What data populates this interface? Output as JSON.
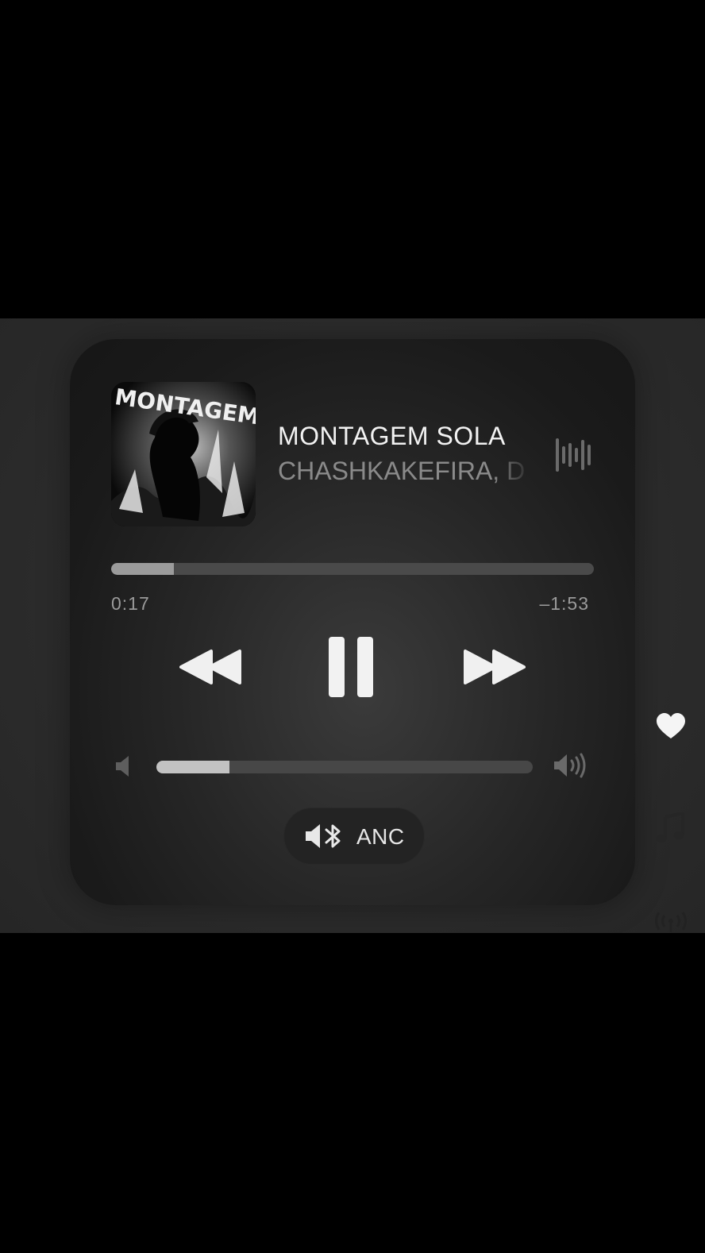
{
  "now_playing": {
    "title": "MONTAGEM SOLA",
    "artist": "CHASHKAKEFIRA, D",
    "album_art_text": "MONTAGEM"
  },
  "playback": {
    "elapsed": "0:17",
    "remaining": "–1:53",
    "progress_fraction": 0.13,
    "state": "playing"
  },
  "volume": {
    "level_fraction": 0.195
  },
  "audio_output": {
    "mode_label": "ANC",
    "icon": "speaker-bluetooth-icon"
  },
  "side_icons": [
    "heart-icon",
    "music-note-icon",
    "broadcast-icon"
  ],
  "colors": {
    "background": "#000000",
    "card": "#1e1e1e",
    "text_primary": "#f2f2f2",
    "text_secondary": "#8a8a8a"
  }
}
